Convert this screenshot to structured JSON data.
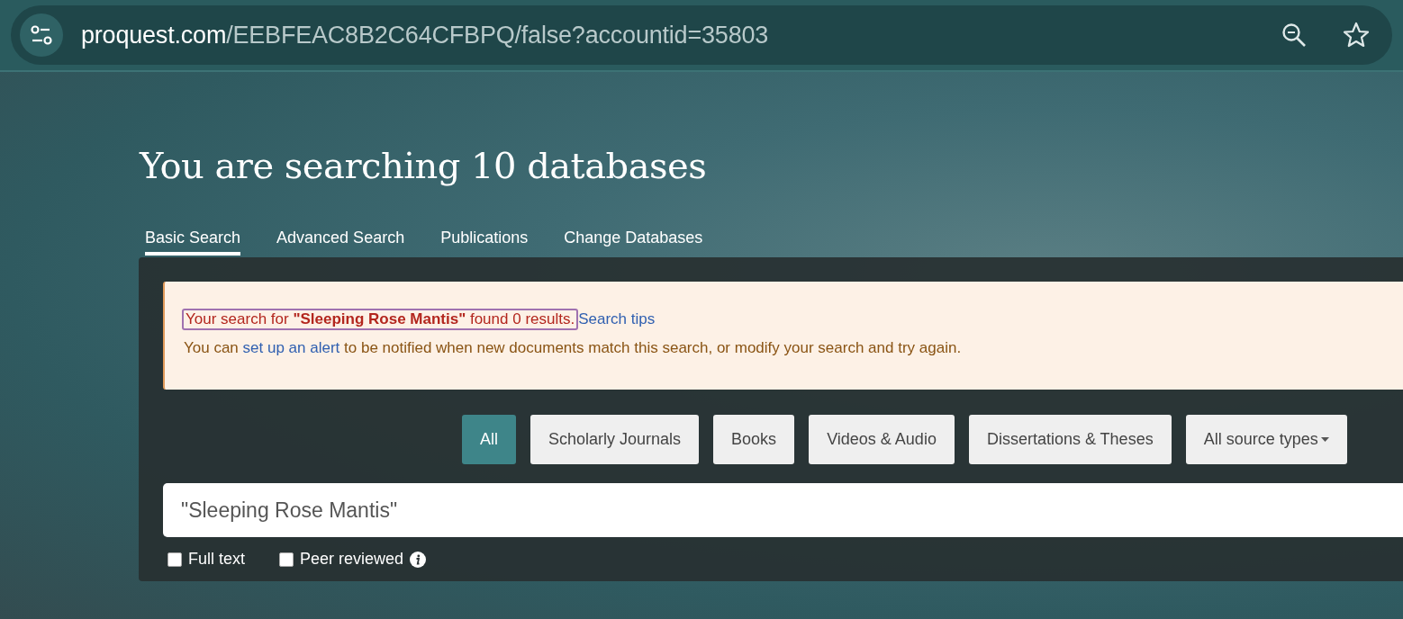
{
  "address_bar": {
    "host": "proquest.com",
    "path": "/EEBFEAC8B2C64CFBPQ/false?accountid=35803"
  },
  "heading": "You are searching 10 databases",
  "tabs": [
    {
      "label": "Basic Search",
      "selected": true
    },
    {
      "label": "Advanced Search",
      "selected": false
    },
    {
      "label": "Publications",
      "selected": false
    },
    {
      "label": "Change Databases",
      "selected": false
    }
  ],
  "notice": {
    "message": "Your search for **\"Sleeping Rose Mantis\"** found 0 results.",
    "tips_link": "Search tips",
    "hint_before": "You can ",
    "hint_link": "set up an alert",
    "hint_after": " to be notified when new documents match this search, or modify your search and try again."
  },
  "source_types": [
    {
      "label": "All",
      "selected": true,
      "kind": "button"
    },
    {
      "label": "Scholarly Journals",
      "selected": false,
      "kind": "button"
    },
    {
      "label": "Books",
      "selected": false,
      "kind": "button"
    },
    {
      "label": "Videos & Audio",
      "selected": false,
      "kind": "button"
    },
    {
      "label": "Dissertations & Theses",
      "selected": false,
      "kind": "button"
    },
    {
      "label": "All source types",
      "selected": false,
      "kind": "dropdown"
    }
  ],
  "search": {
    "value": "\"Sleeping Rose Mantis\""
  },
  "filters": [
    {
      "label": "Full text",
      "checked": false,
      "info": false
    },
    {
      "label": "Peer reviewed",
      "checked": false,
      "info": true
    }
  ]
}
